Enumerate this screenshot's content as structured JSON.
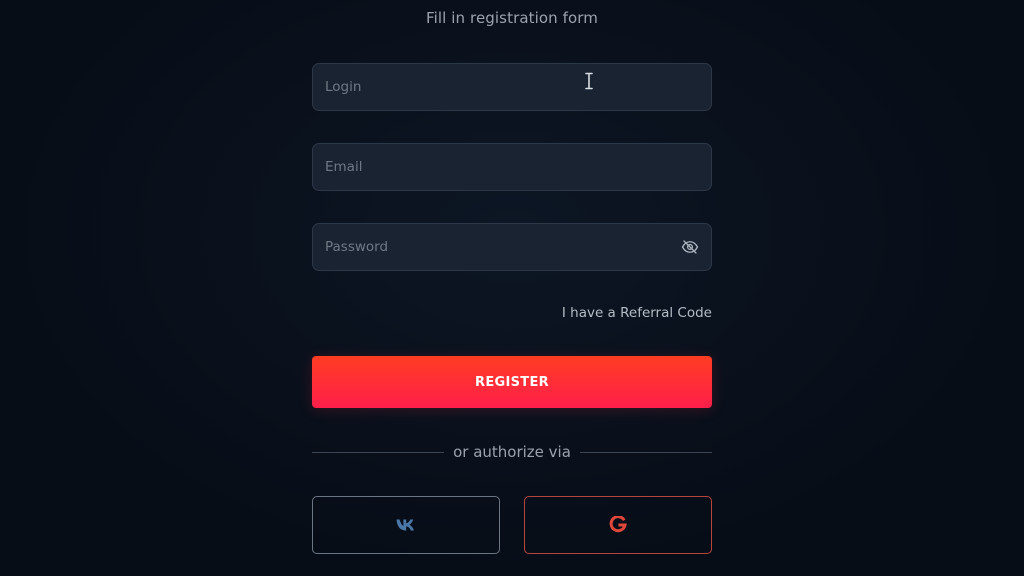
{
  "form": {
    "title": "Fill in registration form",
    "login": {
      "placeholder": "Login",
      "value": ""
    },
    "email": {
      "placeholder": "Email",
      "value": ""
    },
    "password": {
      "placeholder": "Password",
      "value": "",
      "toggle_icon": "eye-slash-icon"
    },
    "referral_label": "I have a Referral Code",
    "register_label": "REGISTER",
    "divider_label": "or authorize via"
  },
  "social": {
    "vk": {
      "icon": "vk-logo-icon",
      "color": "#4a76a8"
    },
    "google": {
      "icon": "google-logo-icon",
      "color": "#e0463a"
    }
  },
  "colors": {
    "background": "#080f1a",
    "field_background": "#1a2331",
    "accent_start": "#ff3d22",
    "accent_end": "#ff1f4b"
  }
}
